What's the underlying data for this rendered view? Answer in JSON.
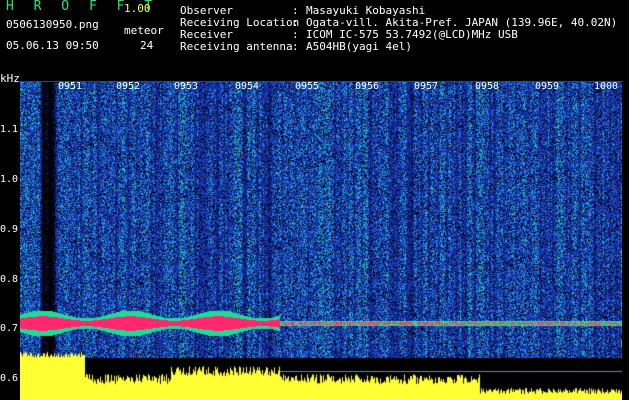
{
  "app": {
    "title": "HROFFT",
    "version": "1.00"
  },
  "file_name": "0506130950.png",
  "date_time": "05.06.13 09:50",
  "meteor": {
    "label": "meteor",
    "count": "24"
  },
  "info": [
    {
      "key": "Observer",
      "value": "Masayuki Kobayashi"
    },
    {
      "key": "Receiving Location",
      "value": "Ogata-vill. Akita-Pref. JAPAN (139.96E, 40.02N)"
    },
    {
      "key": "Receiver",
      "value": "ICOM IC-575 53.7492(@LCD)MHz USB"
    },
    {
      "key": "Receiving antenna",
      "value": "A504HB(yagi 4el)"
    }
  ],
  "info_separator": ":",
  "spectrogram": {
    "unit": "kHz",
    "y_ticks": [
      "1.1",
      "1.0",
      "0.9",
      "0.8",
      "0.7",
      "0.6"
    ],
    "time_marks": [
      "0951",
      "0952",
      "0953",
      "0954",
      "0955",
      "0956",
      "0957",
      "0958",
      "0959",
      "1000"
    ]
  },
  "colors": {
    "label_green": "#2fe07a",
    "background": "#000000",
    "noise_blue": "#1c3ea8",
    "signal_red": "#ff2a6a",
    "level_yellow": "#ffff33"
  }
}
